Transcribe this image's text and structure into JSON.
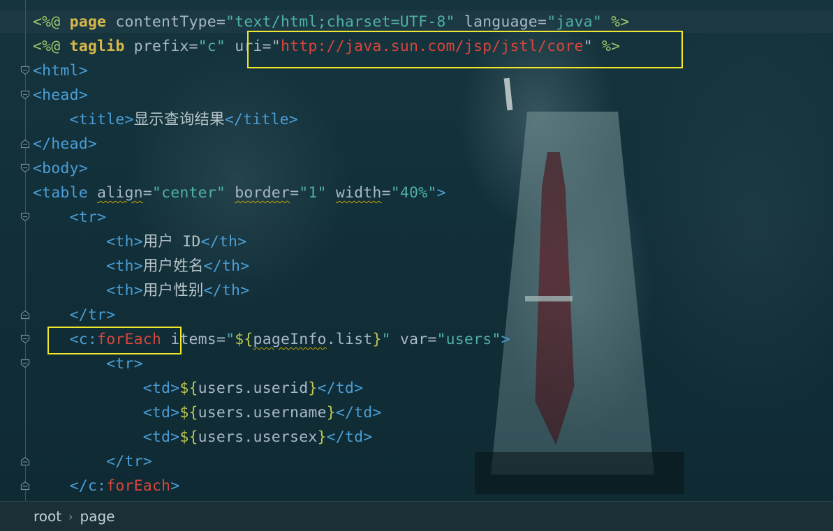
{
  "editor": {
    "lines": [
      {
        "tokens": [
          [
            "c-delim",
            "<%@"
          ],
          [
            "c-text",
            " "
          ],
          [
            "c-kw",
            "page"
          ],
          [
            "c-attr",
            " contentType="
          ],
          [
            "c-str",
            "\"text/html;charset=UTF-8\""
          ],
          [
            "c-attr",
            " language="
          ],
          [
            "c-str",
            "\"java\""
          ],
          [
            "c-text",
            " "
          ],
          [
            "c-delim",
            "%>"
          ]
        ]
      },
      {
        "tokens": [
          [
            "c-delim",
            "<%@"
          ],
          [
            "c-text",
            " "
          ],
          [
            "c-kw",
            "taglib"
          ],
          [
            "c-attr",
            " prefix="
          ],
          [
            "c-str",
            "\"c\""
          ],
          [
            "c-attr",
            " uri=\""
          ],
          [
            "c-url",
            "http://java.sun.com/jsp/jstl/core"
          ],
          [
            "c-attr",
            "\""
          ],
          [
            "c-text",
            " "
          ],
          [
            "c-delim",
            "%>"
          ]
        ]
      },
      {
        "tokens": [
          [
            "c-tag",
            "<html>"
          ]
        ]
      },
      {
        "tokens": [
          [
            "c-tag",
            "<head>"
          ]
        ]
      },
      {
        "tokens": [
          [
            "c-text",
            "    "
          ],
          [
            "c-tag",
            "<title>"
          ],
          [
            "c-text",
            "显示查询结果"
          ],
          [
            "c-tag",
            "</title>"
          ]
        ]
      },
      {
        "tokens": [
          [
            "c-tag",
            "</head>"
          ]
        ]
      },
      {
        "tokens": [
          [
            "c-tag",
            "<body>"
          ]
        ]
      },
      {
        "tokens": [
          [
            "c-tag",
            "<table"
          ],
          [
            "c-text",
            " "
          ],
          [
            "c-attr underline",
            "align"
          ],
          [
            "c-attr",
            "="
          ],
          [
            "c-str",
            "\"center\""
          ],
          [
            "c-text",
            " "
          ],
          [
            "c-attr underline",
            "border"
          ],
          [
            "c-attr",
            "="
          ],
          [
            "c-str",
            "\"1\""
          ],
          [
            "c-text",
            " "
          ],
          [
            "c-attr underline",
            "width"
          ],
          [
            "c-attr",
            "="
          ],
          [
            "c-str",
            "\"40%\""
          ],
          [
            "c-tag",
            ">"
          ]
        ]
      },
      {
        "tokens": [
          [
            "c-text",
            "    "
          ],
          [
            "c-tag",
            "<tr>"
          ]
        ]
      },
      {
        "tokens": [
          [
            "c-text",
            "        "
          ],
          [
            "c-tag",
            "<th>"
          ],
          [
            "c-text",
            "用户 ID"
          ],
          [
            "c-tag",
            "</th>"
          ]
        ]
      },
      {
        "tokens": [
          [
            "c-text",
            "        "
          ],
          [
            "c-tag",
            "<th>"
          ],
          [
            "c-text",
            "用户姓名"
          ],
          [
            "c-tag",
            "</th>"
          ]
        ]
      },
      {
        "tokens": [
          [
            "c-text",
            "        "
          ],
          [
            "c-tag",
            "<th>"
          ],
          [
            "c-text",
            "用户性别"
          ],
          [
            "c-tag",
            "</th>"
          ]
        ]
      },
      {
        "tokens": [
          [
            "c-text",
            "    "
          ],
          [
            "c-tag",
            "</tr>"
          ]
        ]
      },
      {
        "tokens": [
          [
            "c-text",
            "    "
          ],
          [
            "c-tag",
            "<"
          ],
          [
            "c-nsc",
            "c"
          ],
          [
            "c-tag",
            ":"
          ],
          [
            "c-ns",
            "forEach"
          ],
          [
            "c-text",
            " "
          ],
          [
            "c-attr",
            "items="
          ],
          [
            "c-str",
            "\""
          ],
          [
            "c-brace",
            "${"
          ],
          [
            "c-attr underline",
            "pageInfo"
          ],
          [
            "c-attr",
            ".list"
          ],
          [
            "c-brace",
            "}"
          ],
          [
            "c-str",
            "\""
          ],
          [
            "c-attr",
            " var="
          ],
          [
            "c-str",
            "\"users\""
          ],
          [
            "c-tag",
            ">"
          ]
        ]
      },
      {
        "tokens": [
          [
            "c-text",
            "        "
          ],
          [
            "c-tag",
            "<tr>"
          ]
        ]
      },
      {
        "tokens": [
          [
            "c-text",
            "            "
          ],
          [
            "c-tag",
            "<td>"
          ],
          [
            "c-brace",
            "${"
          ],
          [
            "c-attr",
            "users.userid"
          ],
          [
            "c-brace",
            "}"
          ],
          [
            "c-tag",
            "</td>"
          ]
        ]
      },
      {
        "tokens": [
          [
            "c-text",
            "            "
          ],
          [
            "c-tag",
            "<td>"
          ],
          [
            "c-brace",
            "${"
          ],
          [
            "c-attr",
            "users.username"
          ],
          [
            "c-brace",
            "}"
          ],
          [
            "c-tag",
            "</td>"
          ]
        ]
      },
      {
        "tokens": [
          [
            "c-text",
            "            "
          ],
          [
            "c-tag",
            "<td>"
          ],
          [
            "c-brace",
            "${"
          ],
          [
            "c-attr",
            "users.usersex"
          ],
          [
            "c-brace",
            "}"
          ],
          [
            "c-tag",
            "</td>"
          ]
        ]
      },
      {
        "tokens": [
          [
            "c-text",
            "        "
          ],
          [
            "c-tag",
            "</tr>"
          ]
        ]
      },
      {
        "tokens": [
          [
            "c-text",
            "    "
          ],
          [
            "c-tag",
            "</"
          ],
          [
            "c-nsc",
            "c"
          ],
          [
            "c-tag",
            ":"
          ],
          [
            "c-ns",
            "forEach"
          ],
          [
            "c-tag",
            ">"
          ]
        ]
      }
    ]
  },
  "statusbar": {
    "breadcrumb": [
      "root",
      "page"
    ],
    "separator": "›"
  },
  "colors": {
    "highlight_box": "#f0e82a",
    "background": "#102a33"
  }
}
